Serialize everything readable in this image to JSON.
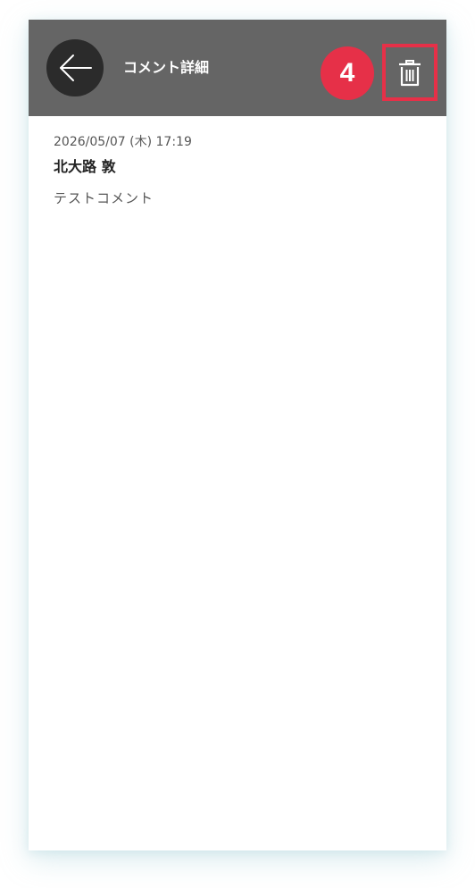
{
  "header": {
    "title": "コメント詳細",
    "step_badge": "4",
    "back_icon": "arrow-left-icon",
    "delete_icon": "trash-icon"
  },
  "comment": {
    "date": "2026/05/07 (木) 17:19",
    "author": "北大路 敦",
    "body": "テストコメント"
  },
  "colors": {
    "header_bg": "#656565",
    "back_button_bg": "#2b2b2b",
    "highlight": "#e63048"
  }
}
